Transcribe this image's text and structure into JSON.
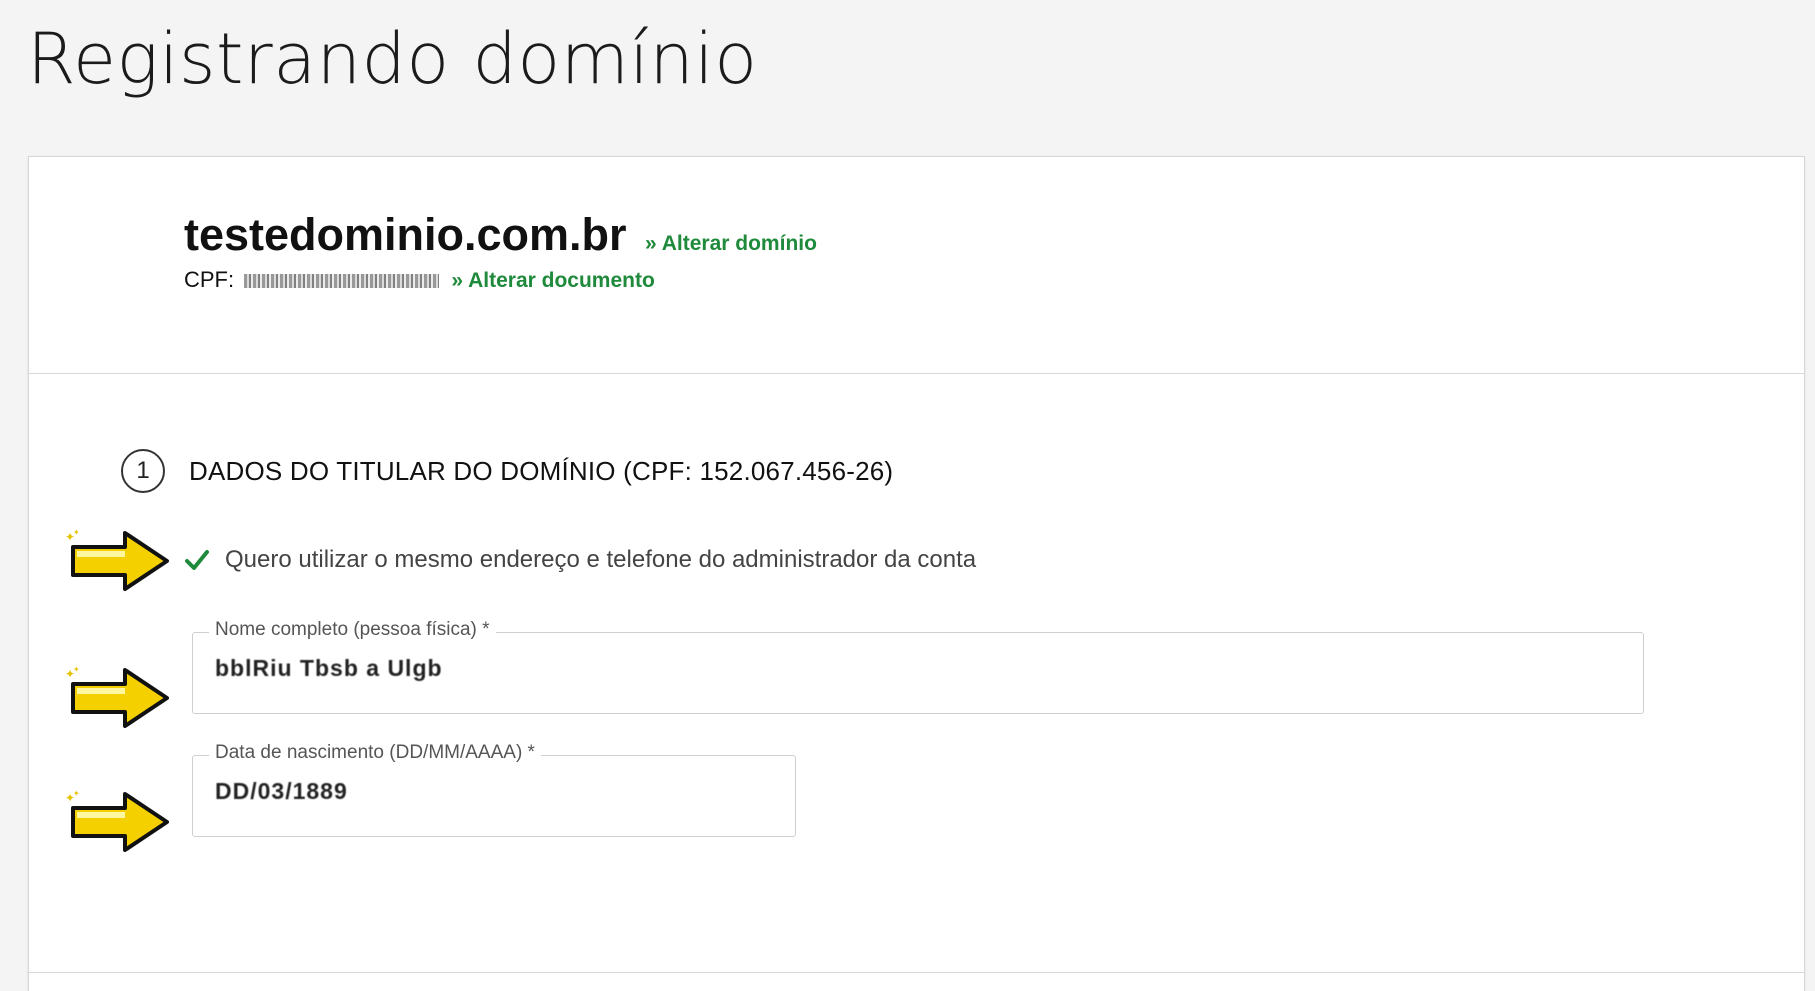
{
  "page": {
    "title": "Registrando domínio"
  },
  "header": {
    "domain": "testedominio.com.br",
    "change_domain": "» Alterar domínio",
    "doc_label": "CPF:",
    "change_document": "» Alterar documento"
  },
  "section": {
    "step_number": "1",
    "title": "DADOS DO TITULAR DO DOMÍNIO (CPF: 152.067.456-26)",
    "same_address_checkbox": {
      "checked": true,
      "label": "Quero utilizar o mesmo endereço e telefone do administrador da conta"
    },
    "fields": {
      "full_name": {
        "label": "Nome completo (pessoa física) *",
        "value": "bblRiu Tbsb a Ulgb"
      },
      "birth_date": {
        "label": "Data de nascimento (DD/MM/AAAA) *",
        "value": "DD/03/1889"
      }
    }
  },
  "colors": {
    "link_green": "#1f8a3b",
    "arrow_yellow": "#f5d000",
    "border": "#cfcfcf"
  },
  "icons": {
    "pointer_arrow": "arrow-right-icon",
    "check": "check-icon"
  }
}
